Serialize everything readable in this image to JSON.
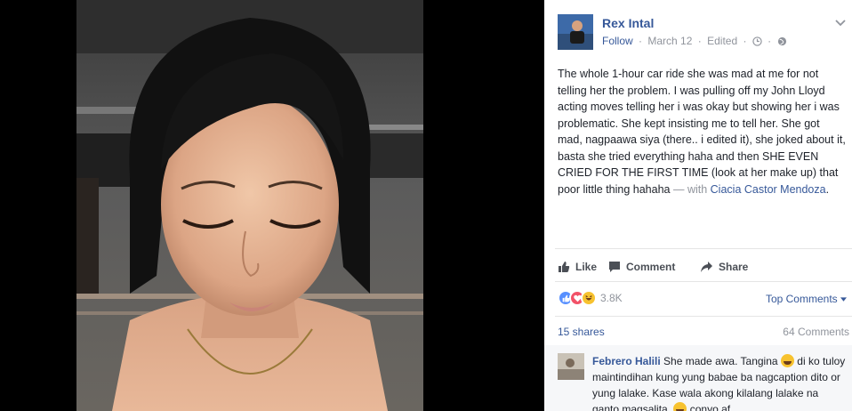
{
  "post": {
    "author": "Rex Intal",
    "follow": "Follow",
    "date": "March 12",
    "edited": "Edited",
    "meta_separator": "·",
    "text": "The whole 1-hour car ride she was mad at me for not telling her the problem. I was pulling off my John Lloyd acting moves telling her i was okay but showing her i was problematic. She kept insisting me to tell her. She got mad, nagpaawa siya (there.. i edited it), she joked about it, basta she tried everything haha and then SHE EVEN CRIED FOR THE FIRST TIME (look at her make up) that poor little thing hahaha",
    "with_label": "— with",
    "tagged": "Ciacia Castor Mendoza",
    "tagged_suffix": "."
  },
  "actions": {
    "like": "Like",
    "comment": "Comment",
    "share": "Share"
  },
  "reactions": {
    "count": "3.8K",
    "types": [
      "like",
      "love",
      "haha"
    ],
    "top_comments": "Top Comments"
  },
  "stats": {
    "shares": "15 shares",
    "comments": "64 Comments"
  },
  "comment": {
    "author": "Febrero Halili",
    "text_1": "She made awa. Tangina",
    "text_2": "di ko tuloy maintindihan kung yung babae ba nagcaption dito or yung lalake. Kase wala akong kilalang lalake na ganto magsalita.",
    "text_3": "conyo af."
  },
  "icons": {
    "options": "chevron-down-icon",
    "clock": "clock-icon",
    "globe": "globe-icon",
    "like": "thumbs-up-icon",
    "comment": "comment-bubble-icon",
    "share": "share-arrow-icon",
    "emoji": "laughing-face-emoji"
  },
  "colors": {
    "link": "#365899",
    "secondary_text": "#90949c",
    "body_text": "#1d2129",
    "like_blue": "#5890ff",
    "love_red": "#f25268",
    "haha_yellow": "#f7c22f"
  }
}
